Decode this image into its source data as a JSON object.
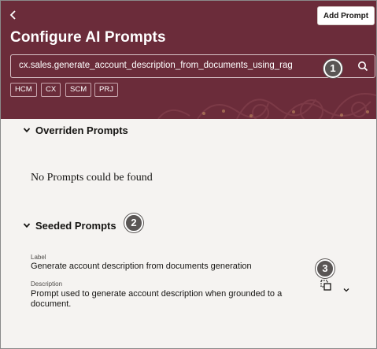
{
  "header": {
    "back_icon": "chevron-left-icon",
    "add_prompt_label": "Add Prompt",
    "title": "Configure AI Prompts",
    "background_color": "#6b2c3a"
  },
  "search": {
    "value": "cx.sales.generate_account_description_from_documents_using_rag",
    "icon": "search-icon"
  },
  "filters": {
    "chips": [
      "HCM",
      "CX",
      "SCM",
      "PRJ"
    ]
  },
  "callouts": {
    "one": "1",
    "two": "2",
    "three": "3"
  },
  "overridden": {
    "title": "Overriden Prompts",
    "empty_message": "No Prompts could be found"
  },
  "seeded": {
    "title": "Seeded Prompts",
    "items": [
      {
        "label_caption": "Label",
        "label": "Generate account description from documents generation",
        "description_caption": "Description",
        "description_line1": "Prompt used to generate account description when grounded to a",
        "description_line2": "document.",
        "actions": [
          "copy-icon",
          "chevron-down-icon"
        ]
      }
    ]
  }
}
